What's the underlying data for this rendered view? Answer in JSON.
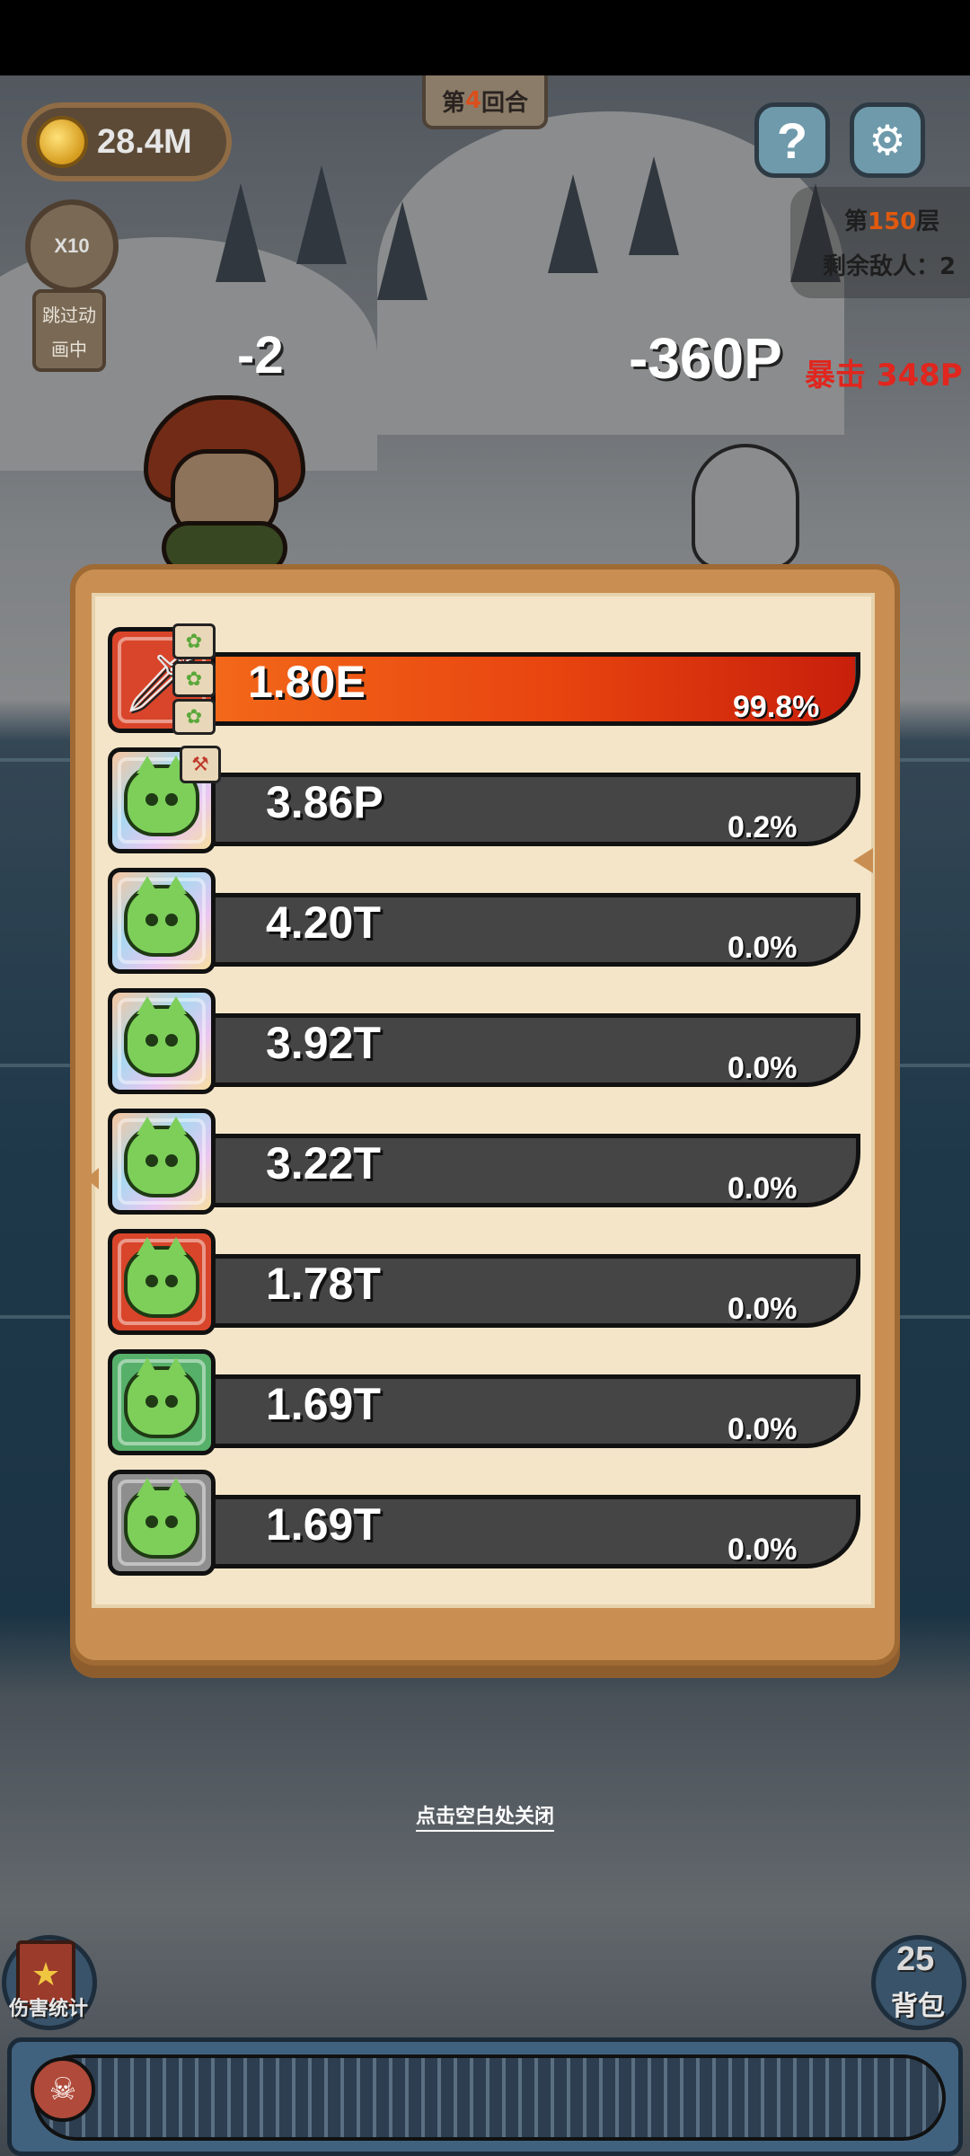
{
  "hud": {
    "coins": "28.4M",
    "round_prefix": "第",
    "round_number": "4",
    "round_suffix": "回合",
    "help_label": "?",
    "level_prefix": "第",
    "level_number": "150",
    "level_suffix": "层",
    "enemies_remaining": "剩余敌人：2",
    "speed_label": "X10",
    "skip_animation": [
      "跳过动",
      "画中"
    ]
  },
  "combat": {
    "player_damage": "-2",
    "enemy_damage": "-360P",
    "crit_text": "暴击 348P"
  },
  "damage_stats": {
    "rows": [
      {
        "icon": "sword-icon",
        "tile": "red",
        "value": "1.80E",
        "percent": "99.8%",
        "fill": 0.998
      },
      {
        "icon": "green-slime-icon",
        "tile": "rainbow",
        "value": "3.86P",
        "percent": "0.2%",
        "fill": 0.0
      },
      {
        "icon": "green-slime-icon",
        "tile": "rainbow",
        "value": "4.20T",
        "percent": "0.0%",
        "fill": 0.0
      },
      {
        "icon": "green-slime-icon",
        "tile": "rainbow",
        "value": "3.92T",
        "percent": "0.0%",
        "fill": 0.0
      },
      {
        "icon": "green-slime-icon",
        "tile": "rainbow",
        "value": "3.22T",
        "percent": "0.0%",
        "fill": 0.0
      },
      {
        "icon": "green-slime-icon",
        "tile": "red",
        "value": "1.78T",
        "percent": "0.0%",
        "fill": 0.0
      },
      {
        "icon": "green-slime-icon",
        "tile": "green",
        "value": "1.69T",
        "percent": "0.0%",
        "fill": 0.0
      },
      {
        "icon": "green-slime-icon",
        "tile": "gray",
        "value": "1.69T",
        "percent": "0.0%",
        "fill": 0.0
      }
    ]
  },
  "close_hint": "点击空白处关闭",
  "bottom": {
    "stats_label": "伤害统计",
    "bag_count": "25",
    "bag_label": "背包"
  },
  "colors": {
    "panel_frame": "#c98f52",
    "panel_bg": "#f4e5c8",
    "bar_fill": "#e8440f",
    "bar_empty": "#454545",
    "crit": "#e0261e"
  }
}
